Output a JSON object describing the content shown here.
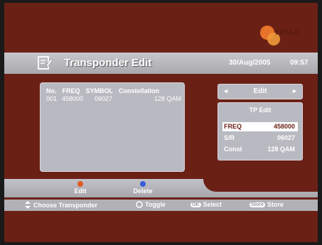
{
  "logo": {
    "brand": "TRIAX"
  },
  "title": {
    "text": "Transponder Edit",
    "date": "30/Aug/2005",
    "time": "09:57"
  },
  "list": {
    "headers": [
      "No.",
      "FREQ",
      "SYMBOL",
      "Constellation"
    ],
    "rows": [
      {
        "no": "001",
        "freq": "458000",
        "symbol": "06027",
        "constellation": "128 QAM"
      }
    ]
  },
  "mode": {
    "label": "Edit",
    "left": "◄",
    "right": "►"
  },
  "tp_edit": {
    "title": "TP Edit",
    "fields": [
      {
        "key": "FREQ",
        "value": "458000",
        "selected": true
      },
      {
        "key": "S/R",
        "value": "06027",
        "selected": false
      },
      {
        "key": "Const",
        "value": "128 QAM",
        "selected": false
      }
    ]
  },
  "softkeys": {
    "edit": {
      "label": "Edit",
      "color": "#e05a22"
    },
    "delete": {
      "label": "Delete",
      "color": "#3a5bd8"
    }
  },
  "help": {
    "choose": "Choose Transponder",
    "toggle": "Toggle",
    "select_key": "OK",
    "select": "Select",
    "store_key": "Store",
    "store": "Store"
  },
  "colors": {
    "background": "#6b2016",
    "panel": "#b9b9c2"
  }
}
